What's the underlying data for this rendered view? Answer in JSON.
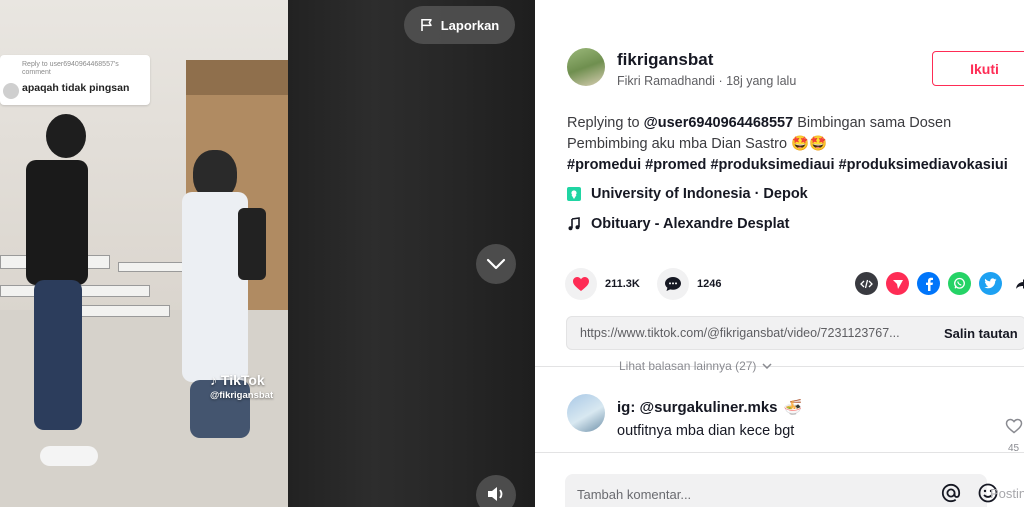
{
  "video": {
    "reply_context": "Reply to user6940964468557's comment",
    "reply_text": "apaqah tidak pingsan",
    "watermark_logo": "TikTok",
    "watermark_handle": "@fikrigansbat",
    "report_label": "Laporkan"
  },
  "author": {
    "username": "fikrigansbat",
    "display_name": "Fikri Ramadhandi",
    "separator": " · ",
    "time_ago": "18j yang lalu",
    "follow_label": "Ikuti"
  },
  "description": {
    "prefix": "Replying to ",
    "mention": "@user6940964468557",
    "text": " Bimbingan sama Dosen Pembimbing aku mba Dian Sastro 🤩🤩",
    "hashtags": [
      "#promedui",
      "#promed",
      "#produksimediaui",
      "#produksimediavokasiui"
    ]
  },
  "location": "University of Indonesia · Depok",
  "music": "Obituary - Alexandre Desplat",
  "stats": {
    "likes": "211.3K",
    "comments": "1246"
  },
  "share": {
    "icons": [
      "embed-icon",
      "send-icon",
      "facebook-icon",
      "whatsapp-icon",
      "twitter-icon",
      "share-arrow-icon"
    ],
    "colors": {
      "embed": "#393a40",
      "send": "#fe2c55",
      "facebook": "#0075fa",
      "whatsapp": "#25d366",
      "twitter": "#1da1f2"
    }
  },
  "link": {
    "url": "https://www.tiktok.com/@fikrigansbat/video/7231123767...",
    "copy_label": "Salin tautan"
  },
  "comments": {
    "more_replies": "Lihat balasan lainnya (27)",
    "items": [
      {
        "user": "ig: @surgakuliner.mks",
        "emoji": "🍜",
        "text": "outfitnya mba dian kece bgt",
        "likes": "45"
      }
    ]
  },
  "comment_input": {
    "placeholder": "Tambah komentar...",
    "post_label": "Posting"
  },
  "colors": {
    "accent": "#fe2c55",
    "text": "#161823",
    "muted": "#8a8b91"
  }
}
